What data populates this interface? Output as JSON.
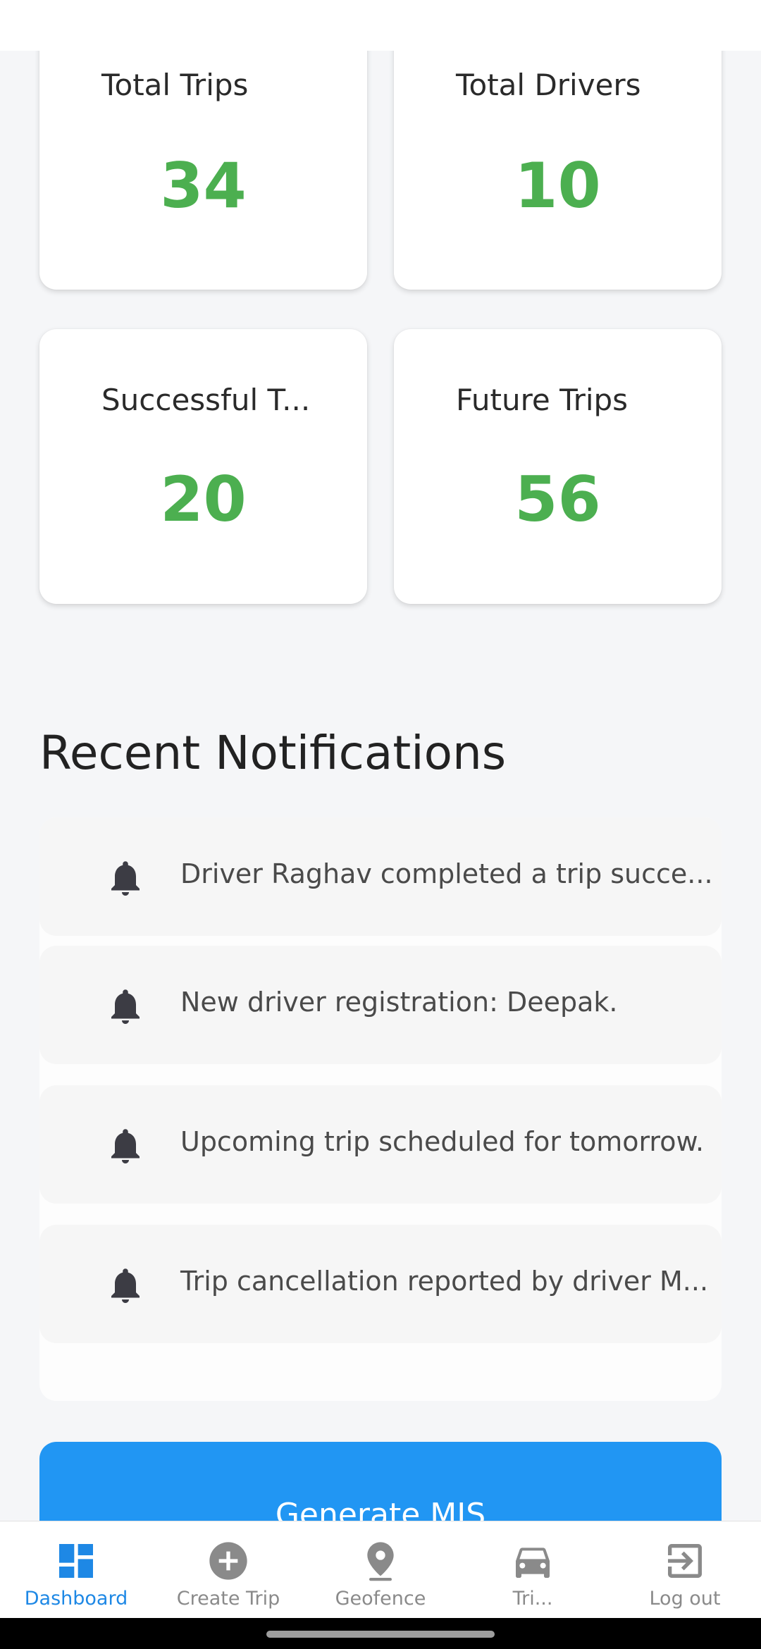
{
  "stats": [
    {
      "label": "Total Trips",
      "value": "34"
    },
    {
      "label": "Total Drivers",
      "value": "10"
    },
    {
      "label": "Successful T...",
      "value": "20"
    },
    {
      "label": "Future Trips",
      "value": "56"
    }
  ],
  "notifications": {
    "title": "Recent Notifications",
    "items": [
      {
        "text": "Driver Raghav completed a trip succe...",
        "icon": "bell-icon"
      },
      {
        "text": "New driver registration: Deepak.",
        "icon": "bell-icon"
      },
      {
        "text": "Upcoming trip scheduled for tomorrow.",
        "icon": "bell-icon"
      },
      {
        "text": "Trip cancellation reported by driver M...",
        "icon": "bell-icon"
      }
    ]
  },
  "actions": {
    "generate_mis": "Generate MIS"
  },
  "nav": [
    {
      "label": "Dashboard",
      "icon": "dashboard-icon",
      "active": true
    },
    {
      "label": "Create Trip",
      "icon": "add-circle-icon",
      "active": false
    },
    {
      "label": "Geofence",
      "icon": "location-pin-icon",
      "active": false
    },
    {
      "label": "Tri...",
      "icon": "car-icon",
      "active": false
    },
    {
      "label": "Log out",
      "icon": "logout-icon",
      "active": false
    }
  ],
  "colors": {
    "accent": "#2196f3",
    "stat_value": "#4caf50",
    "nav_active": "#1e88e5",
    "nav_inactive": "#8a8a8a"
  }
}
